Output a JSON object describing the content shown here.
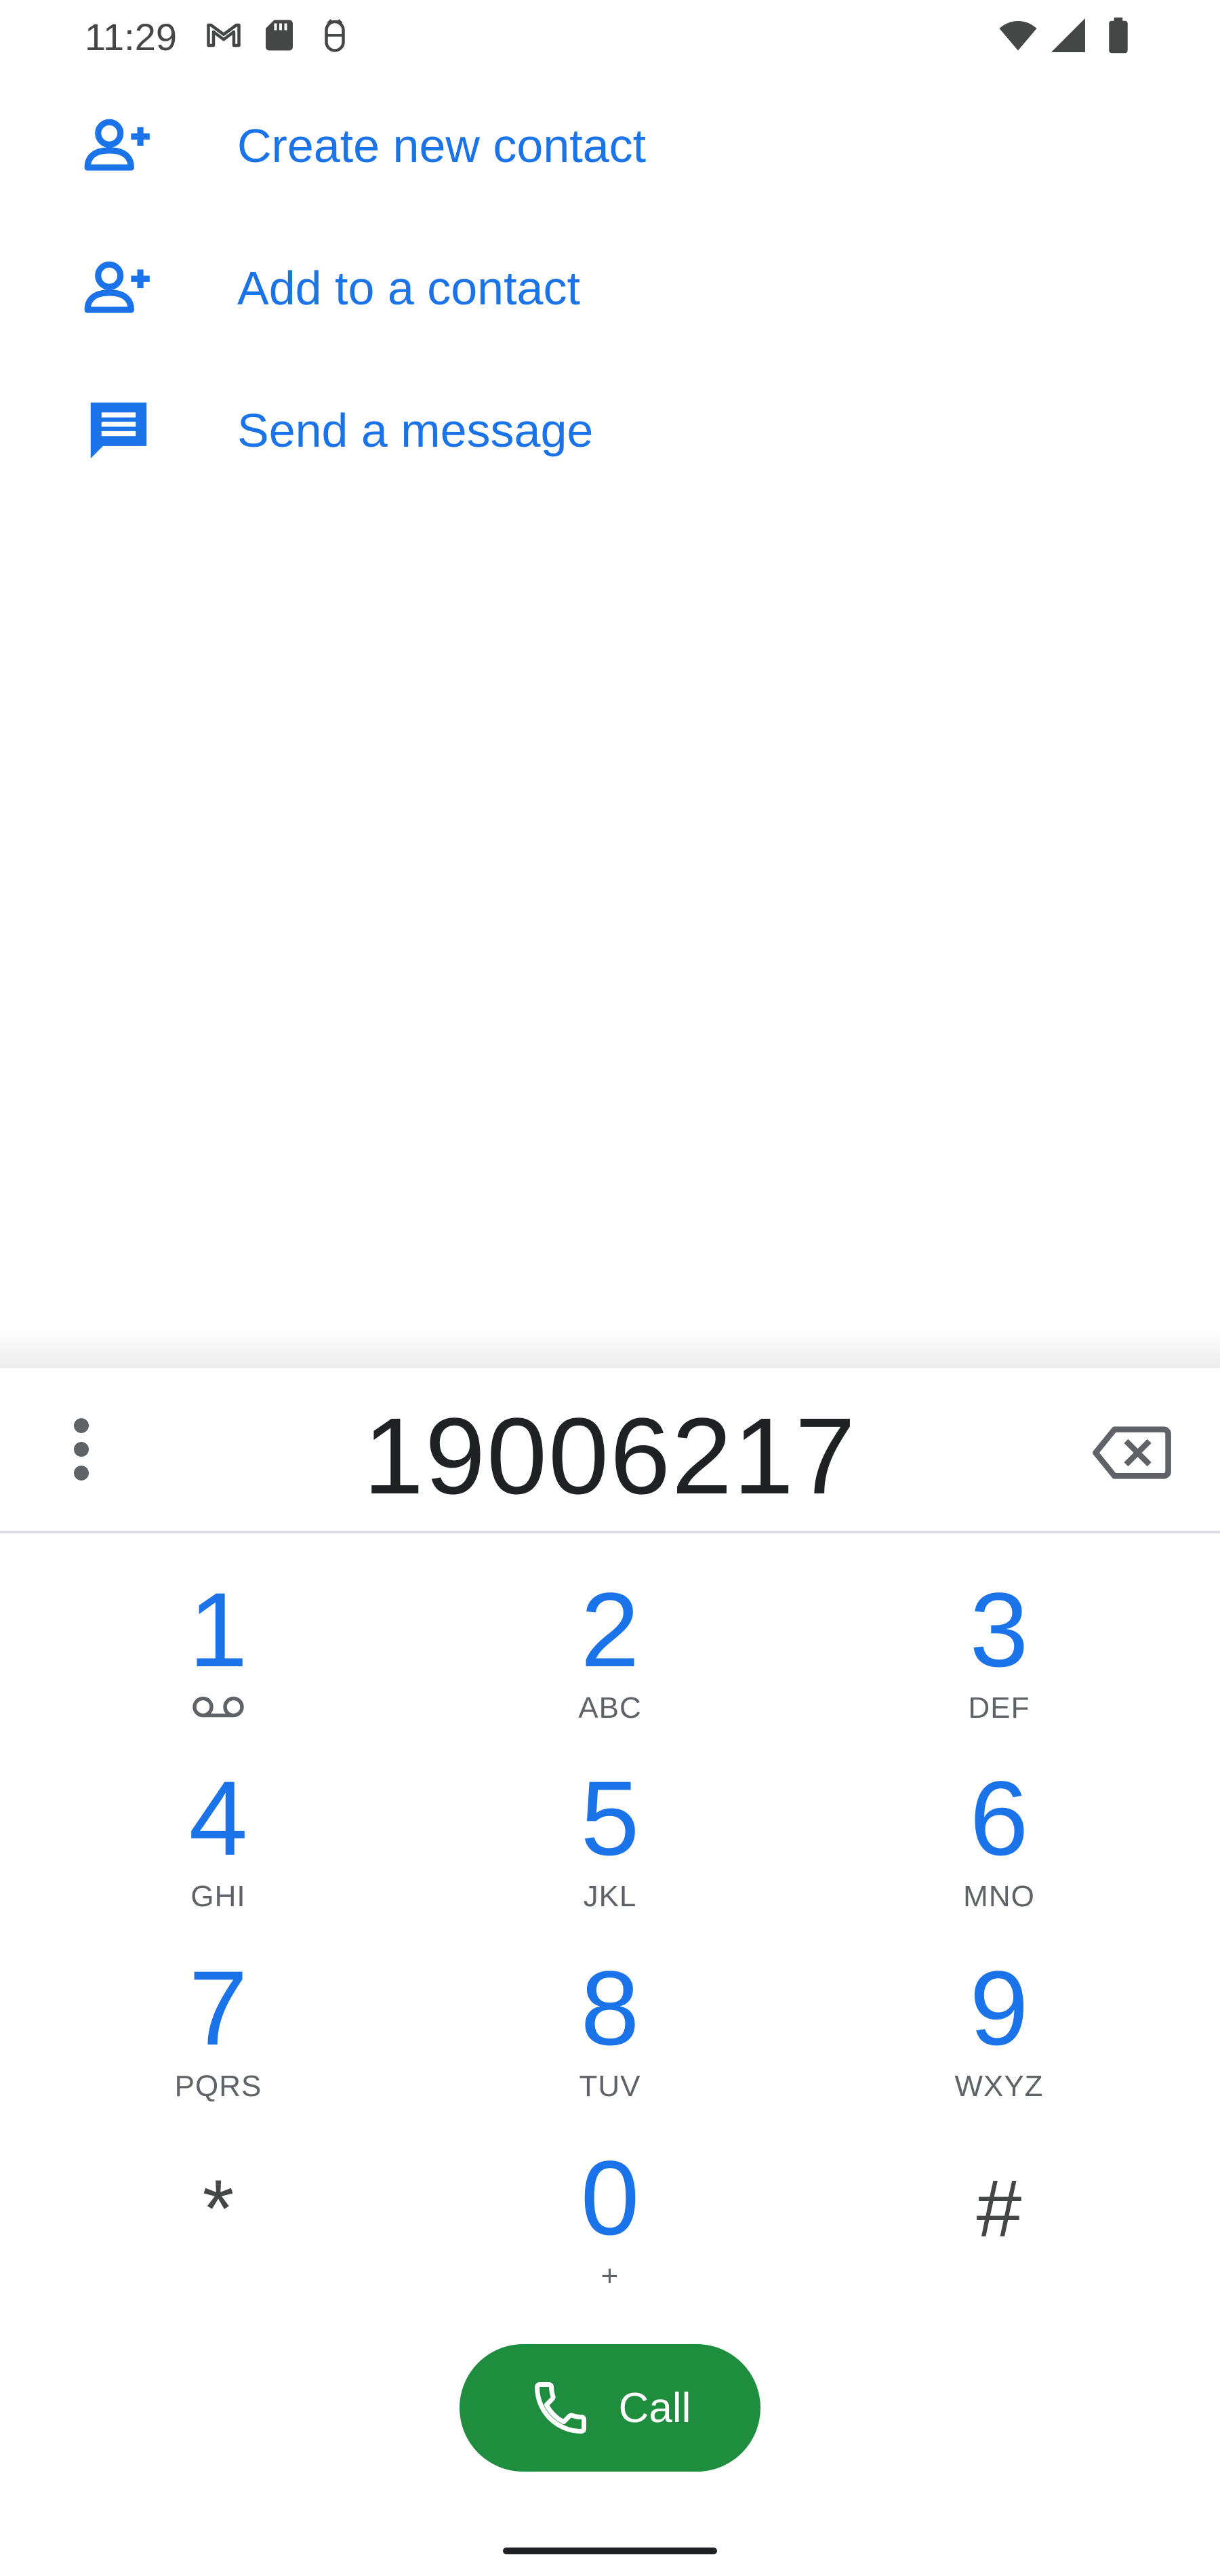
{
  "status_bar": {
    "time": "11:29",
    "icons_left": [
      "gmail-icon",
      "sd-card-icon",
      "debug-icon"
    ],
    "icons_right": [
      "wifi-icon",
      "signal-icon",
      "battery-icon"
    ]
  },
  "actions": [
    {
      "label": "Create new contact",
      "icon": "person-add-icon"
    },
    {
      "label": "Add to a contact",
      "icon": "person-add-icon"
    },
    {
      "label": "Send a message",
      "icon": "message-icon"
    }
  ],
  "dialpad": {
    "entered_number": "19006217",
    "keys": [
      {
        "digit": "1",
        "letters": "",
        "voicemail": true
      },
      {
        "digit": "2",
        "letters": "ABC"
      },
      {
        "digit": "3",
        "letters": "DEF"
      },
      {
        "digit": "4",
        "letters": "GHI"
      },
      {
        "digit": "5",
        "letters": "JKL"
      },
      {
        "digit": "6",
        "letters": "MNO"
      },
      {
        "digit": "7",
        "letters": "PQRS"
      },
      {
        "digit": "8",
        "letters": "TUV"
      },
      {
        "digit": "9",
        "letters": "WXYZ"
      },
      {
        "digit": "*",
        "letters": ""
      },
      {
        "digit": "0",
        "letters": "+"
      },
      {
        "digit": "#",
        "letters": ""
      }
    ],
    "call_label": "Call"
  },
  "colors": {
    "accent": "#1a73e8",
    "call_green": "#1e8e3e",
    "text": "#202124",
    "secondary": "#5f6368"
  }
}
